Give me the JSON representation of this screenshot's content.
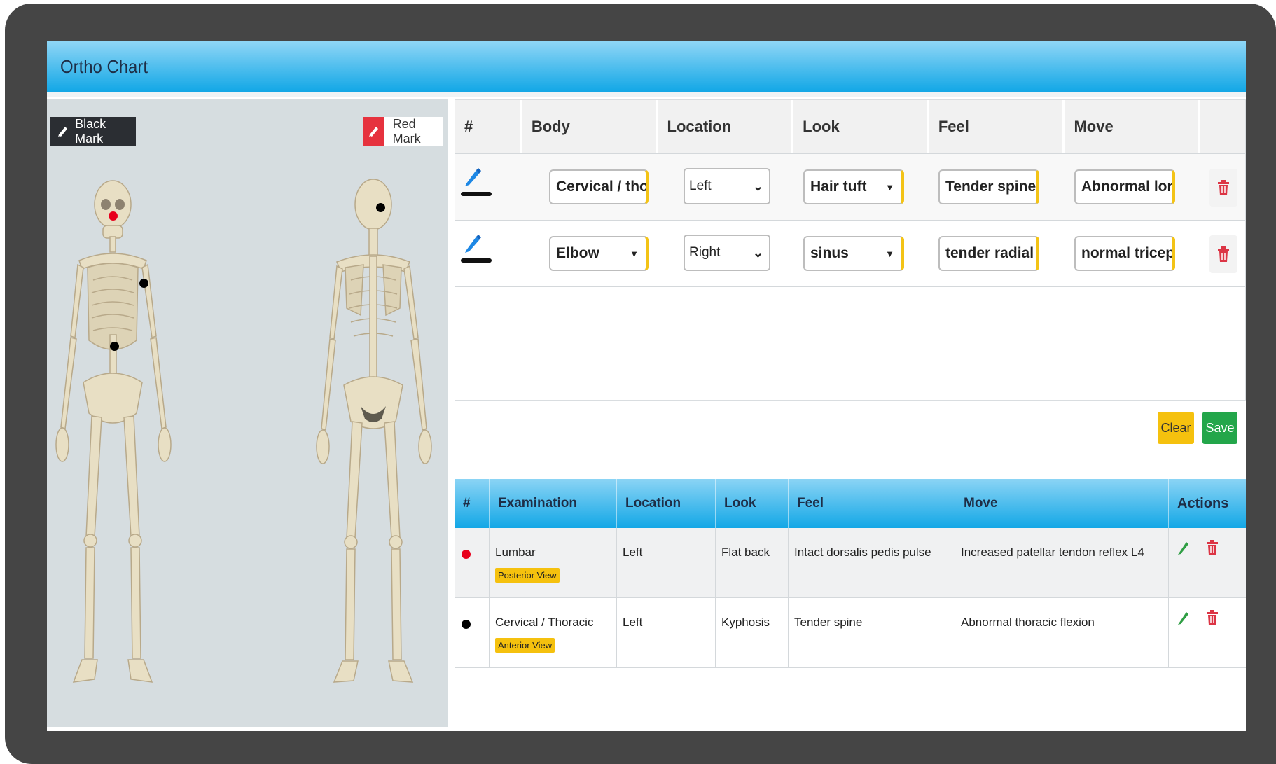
{
  "app": {
    "title": "Ortho Chart"
  },
  "marks": {
    "black_label": "Black Mark",
    "red_label": "Red Mark"
  },
  "entry": {
    "headers": [
      "#",
      "Body",
      "Location",
      "Look",
      "Feel",
      "Move"
    ],
    "rows": [
      {
        "body": "Cervical / thor",
        "location": "Left",
        "look": "Hair tuft",
        "feel": "Tender spine",
        "move": "Abnormal long"
      },
      {
        "body": "Elbow",
        "location": "Right",
        "look": "sinus",
        "feel": "tender radial h",
        "move": "normal triceps"
      }
    ]
  },
  "buttons": {
    "clear": "Clear",
    "save": "Save"
  },
  "records": {
    "headers": [
      "#",
      "Examination",
      "Location",
      "Look",
      "Feel",
      "Move",
      "Actions"
    ],
    "rows": [
      {
        "dot_color": "#e8001c",
        "examination": "Lumbar",
        "view": "Posterior View",
        "location": "Left",
        "look": "Flat back",
        "feel": "Intact dorsalis pedis pulse",
        "move": "Increased patellar tendon reflex L4"
      },
      {
        "dot_color": "#000000",
        "examination": "Cervical / Thoracic",
        "view": "Anterior View",
        "location": "Left",
        "look": "Kyphosis",
        "feel": "Tender spine",
        "move": "Abnormal thoracic flexion"
      }
    ]
  },
  "colors": {
    "header_blue": "#12a7e6",
    "panel_grey": "#d6dde0",
    "mark_red": "#e6323e",
    "bone": "#e8dfc4"
  }
}
